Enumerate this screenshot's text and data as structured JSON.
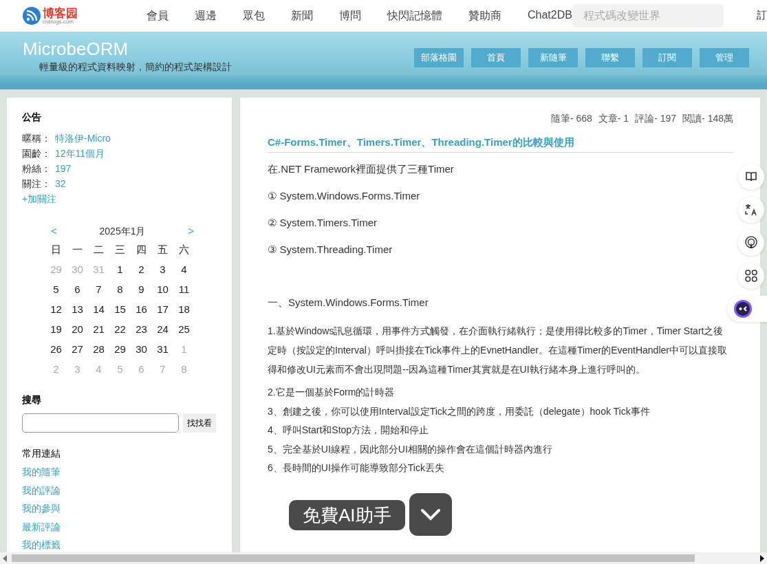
{
  "site": {
    "logo_text": "博客园",
    "logo_sub": "cnblogs.com",
    "nav": [
      "會員",
      "週邊",
      "眾包",
      "新聞",
      "博問",
      "快閃記憶體",
      "贊助商",
      "Chat2DB"
    ],
    "search": {
      "placeholder": "程式碼改變世界"
    },
    "cut_item": "訂"
  },
  "blog": {
    "title": "MicrobeORM",
    "subtitle": "輕量級的程式資料映射，簡約的程式架構設計",
    "buttons": [
      "部落格園",
      "首頁",
      "新隨筆",
      "聯繫",
      "訂閱",
      "管理"
    ]
  },
  "sidebar": {
    "notice_title": "公告",
    "profile": [
      {
        "label": "暱稱：",
        "value": "特洛伊-Micro"
      },
      {
        "label": "園齡：",
        "value": "12年11個月"
      },
      {
        "label": "粉絲：",
        "value": "197"
      },
      {
        "label": "關注：",
        "value": "32"
      }
    ],
    "follow_link": "+加關注",
    "calendar": {
      "prev": "<",
      "month": "2025年1月",
      "next": ">",
      "weekdays": [
        "日",
        "一",
        "二",
        "三",
        "四",
        "五",
        "六"
      ],
      "days": [
        {
          "day": "29",
          "other_month": true
        },
        {
          "day": "30",
          "other_month": true
        },
        {
          "day": "31",
          "other_month": true
        },
        {
          "day": "1",
          "other_month": false
        },
        {
          "day": "2",
          "other_month": false
        },
        {
          "day": "3",
          "other_month": false
        },
        {
          "day": "4",
          "other_month": false
        },
        {
          "day": "5",
          "other_month": false
        },
        {
          "day": "6",
          "other_month": false
        },
        {
          "day": "7",
          "other_month": false
        },
        {
          "day": "8",
          "other_month": false
        },
        {
          "day": "9",
          "other_month": false
        },
        {
          "day": "10",
          "other_month": false
        },
        {
          "day": "11",
          "other_month": false
        },
        {
          "day": "12",
          "other_month": false
        },
        {
          "day": "13",
          "other_month": false
        },
        {
          "day": "14",
          "other_month": false
        },
        {
          "day": "15",
          "other_month": false
        },
        {
          "day": "16",
          "other_month": false
        },
        {
          "day": "17",
          "other_month": false
        },
        {
          "day": "18",
          "other_month": false
        },
        {
          "day": "19",
          "other_month": false
        },
        {
          "day": "20",
          "other_month": false
        },
        {
          "day": "21",
          "other_month": false
        },
        {
          "day": "22",
          "other_month": false
        },
        {
          "day": "23",
          "other_month": false
        },
        {
          "day": "24",
          "other_month": false
        },
        {
          "day": "25",
          "other_month": false
        },
        {
          "day": "26",
          "other_month": false
        },
        {
          "day": "27",
          "other_month": false
        },
        {
          "day": "28",
          "other_month": false
        },
        {
          "day": "29",
          "other_month": false
        },
        {
          "day": "30",
          "other_month": false
        },
        {
          "day": "31",
          "other_month": false
        },
        {
          "day": "1",
          "other_month": true
        },
        {
          "day": "2",
          "other_month": true
        },
        {
          "day": "3",
          "other_month": true
        },
        {
          "day": "4",
          "other_month": true
        },
        {
          "day": "5",
          "other_month": true
        },
        {
          "day": "6",
          "other_month": true
        },
        {
          "day": "7",
          "other_month": true
        },
        {
          "day": "8",
          "other_month": true
        }
      ]
    },
    "search_title": "搜尋",
    "search_button": "找找看",
    "links_title": "常用連結",
    "links": [
      "我的隨筆",
      "我的評論",
      "我的參與",
      "最新評論",
      "我的標籤"
    ]
  },
  "stats": [
    "隨筆- 668",
    "文章- 1",
    "評論- 197",
    "閱讀- 148萬"
  ],
  "post": {
    "title": "C#-Forms.Timer、Timers.Timer、Threading.Timer的比較與使用",
    "intro": [
      "在.NET Framework裡面提供了三種Timer",
      "① System.Windows.Forms.Timer",
      "② System.Timers.Timer",
      "③ System.Threading.Timer"
    ],
    "section": "一、System.Windows.Forms.Timer",
    "paragraph": "1.基於Windows訊息循環，用事件方式觸發，在介面執行緒執行；是使用得比較多的Timer，Timer Start之後定時（按設定的Interval）呼叫掛接在Tick事件上的EvnetHandler。在這種Timer的EventHandler中可以直接取得和修改UI元素而不會出現問題--因為這種Timer其實就是在UI執行緒本身上進行呼叫的。",
    "points": [
      "2.它是一個基於Form的計時器",
      "3、創建之後，你可以使用Interval設定Tick之間的跨度，用委託（delegate）hook Tick事件",
      "4、呼叫Start和Stop方法，開始和停止",
      "5、完全基於UI線程，因此部分UI相關的操作會在這個計時器內進行",
      "6、長時間的UI操作可能導致部分Tick丟失"
    ]
  },
  "side_tools": [
    {
      "kind": "book"
    },
    {
      "kind": "translate"
    },
    {
      "kind": "broadcast"
    },
    {
      "kind": "apps"
    },
    {
      "kind": "assistant"
    }
  ],
  "ai_popup": {
    "label": "免費AI助手"
  }
}
